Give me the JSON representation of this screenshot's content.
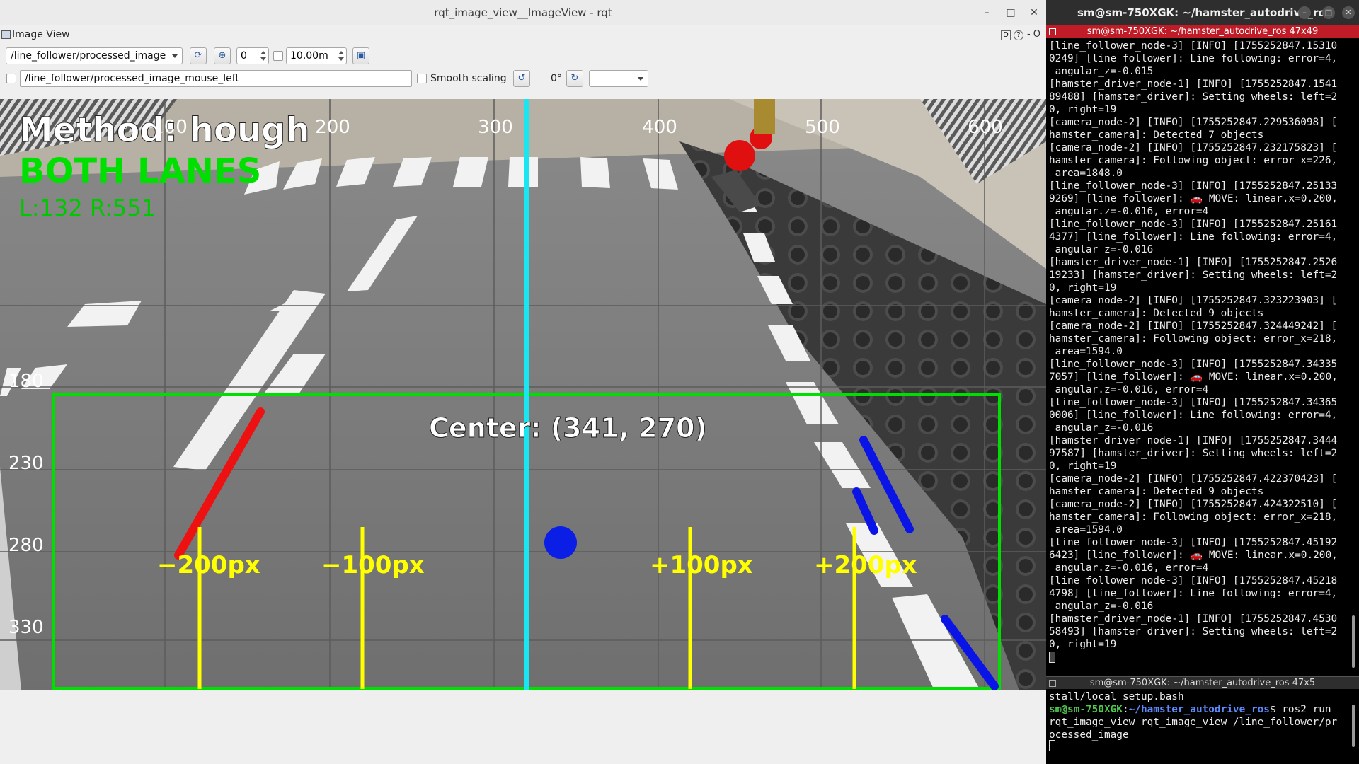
{
  "rqt": {
    "window_title": "rqt_image_view__ImageView - rqt",
    "minimize": "–",
    "maximize": "□",
    "close": "✕",
    "plugin_title": "Image View",
    "plugin_d": "D",
    "plugin_help": "?",
    "plugin_right": "- O",
    "toolbar": {
      "topic": "/line_follower/processed_image",
      "zoom_value": "0",
      "rate_value": "10.00m",
      "mouse_topic": "/line_follower/processed_image_mouse_left",
      "smooth_label": "Smooth scaling",
      "rotation_label": "0°"
    }
  },
  "overlay": {
    "method": "Method: hough",
    "lanes": "BOTH LANES",
    "lr": "L:132 R:551",
    "center": "Center: (341, 270)",
    "grid_top_labels": [
      "100",
      "200",
      "300",
      "400",
      "500",
      "600"
    ],
    "grid_left_labels": [
      "180",
      "230",
      "280",
      "330"
    ],
    "offset_labels": [
      "−200px",
      "−100px",
      "+100px",
      "+200px"
    ],
    "colors": {
      "roi": "#00e000",
      "center_line": "#19e6f0",
      "left_lane": "#ee1111",
      "right_lane": "#0a14e6",
      "offset_lines": "#ffff00",
      "center_dot": "#0a1ee6"
    }
  },
  "terminal": {
    "window_title": "sm@sm-750XGK: ~/hamster_autodrive_ros",
    "tab1_title": "sm@sm-750XGK: ~/hamster_autodrive_ros 47x49",
    "tab2_title": "sm@sm-750XGK: ~/hamster_autodrive_ros 47x5",
    "log_lines": [
      "[line_follower_node-3] [INFO] [1755252847.15310",
      "0249] [line_follower]: Line following: error=4,",
      " angular_z=-0.015",
      "[hamster_driver_node-1] [INFO] [1755252847.1541",
      "89488] [hamster_driver]: Setting wheels: left=2",
      "0, right=19",
      "[camera_node-2] [INFO] [1755252847.229536098] [",
      "hamster_camera]: Detected 7 objects",
      "[camera_node-2] [INFO] [1755252847.232175823] [",
      "hamster_camera]: Following object: error_x=226,",
      " area=1848.0",
      "[line_follower_node-3] [INFO] [1755252847.25133",
      "9269] [line_follower]: 🚗 MOVE: linear.x=0.200,",
      " angular.z=-0.016, error=4",
      "[line_follower_node-3] [INFO] [1755252847.25161",
      "4377] [line_follower]: Line following: error=4,",
      " angular_z=-0.016",
      "[hamster_driver_node-1] [INFO] [1755252847.2526",
      "19233] [hamster_driver]: Setting wheels: left=2",
      "0, right=19",
      "[camera_node-2] [INFO] [1755252847.323223903] [",
      "hamster_camera]: Detected 9 objects",
      "[camera_node-2] [INFO] [1755252847.324449242] [",
      "hamster_camera]: Following object: error_x=218,",
      " area=1594.0",
      "[line_follower_node-3] [INFO] [1755252847.34335",
      "7057] [line_follower]: 🚗 MOVE: linear.x=0.200,",
      " angular.z=-0.016, error=4",
      "[line_follower_node-3] [INFO] [1755252847.34365",
      "0006] [line_follower]: Line following: error=4,",
      " angular_z=-0.016",
      "[hamster_driver_node-1] [INFO] [1755252847.3444",
      "97587] [hamster_driver]: Setting wheels: left=2",
      "0, right=19",
      "[camera_node-2] [INFO] [1755252847.422370423] [",
      "hamster_camera]: Detected 9 objects",
      "[camera_node-2] [INFO] [1755252847.424322510] [",
      "hamster_camera]: Following object: error_x=218,",
      " area=1594.0",
      "[line_follower_node-3] [INFO] [1755252847.45192",
      "6423] [line_follower]: 🚗 MOVE: linear.x=0.200,",
      " angular.z=-0.016, error=4",
      "[line_follower_node-3] [INFO] [1755252847.45218",
      "4798] [line_follower]: Line following: error=4,",
      " angular_z=-0.016",
      "[hamster_driver_node-1] [INFO] [1755252847.4530",
      "58493] [hamster_driver]: Setting wheels: left=2",
      "0, right=19"
    ],
    "tab2_line1": "stall/local_setup.bash",
    "tab2_user": "sm@sm-750XGK",
    "tab2_sep": ":",
    "tab2_path": "~/hamster_autodrive_ros",
    "tab2_cmd": "$ ros2 run",
    "tab2_line3": "rqt_image_view rqt_image_view /line_follower/pr",
    "tab2_line4": "ocessed_image"
  }
}
